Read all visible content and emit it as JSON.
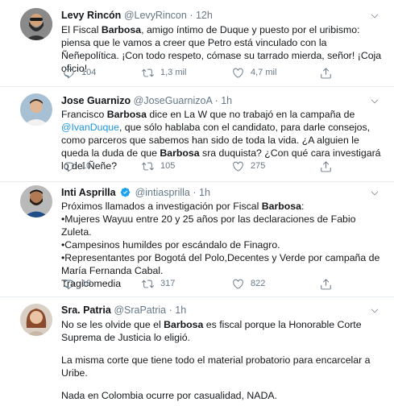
{
  "tweets": [
    {
      "name": "Levy Rincón",
      "handle": "@LevyRincon",
      "sep": "·",
      "time": "12h",
      "avatar_icon": "bearded-man-avatar",
      "text_parts": [
        "El Fiscal ",
        "Barbosa",
        ", amigo íntimo de Duque y puesto por el uribismo: piensa que le vamos a creer que Petro está vinculado con la Ñeñepolítica. ¡Con todo respeto, cómase su tarrado mierda, señor! ¡Coja oficio!"
      ],
      "reply": "104",
      "retweet": "1,3 mil",
      "like": "4,7 mil"
    },
    {
      "name": "Jose Guarnizo",
      "handle": "@JoseGuarnizoA",
      "sep": "·",
      "time": "1h",
      "avatar_icon": "man-avatar",
      "text_parts": [
        "Francisco ",
        "Barbosa",
        " dice en La W que no trabajó en la campaña de ",
        "@IvanDuque",
        ", que sólo hablaba con el candidato, para darle consejos, como parceros que sabemos han sido de toda la vida. ¿A alguien le queda la duda de que ",
        "Barbosa",
        " sra duquista? ¿Con qué cara investigará lo del Ñeñe?"
      ],
      "reply": "10",
      "retweet": "105",
      "like": "275"
    },
    {
      "name": "Inti Asprilla",
      "handle": "@intiasprilla",
      "sep": "·",
      "time": "1h",
      "avatar_icon": "man-with-beard-avatar",
      "lines": [
        [
          "Próximos llamados a investigación por Fiscal ",
          "Barbosa",
          ":"
        ],
        [
          "•Mujeres Wayuu entre 20 y 25 años por las declaraciones de Fabio Zuleta."
        ],
        [
          "•Campesinos humildes por escándalo de Finagro."
        ],
        [
          "•Representantes por Bogotá del Polo,Decentes y Verde por campaña de María Fernanda Cabal."
        ],
        [
          "Tragicomedia"
        ]
      ],
      "reply": "18",
      "retweet": "317",
      "like": "822"
    },
    {
      "name": "Sra. Patria",
      "handle": "@SraPatria",
      "sep": "·",
      "time": "1h",
      "avatar_icon": "woman-avatar",
      "paragraphs": [
        [
          "No se les olvide que el ",
          "Barbosa",
          " es fiscal porque la Honorable Corte Suprema de Justicia lo eligió."
        ],
        [
          "La misma corte que tiene todo el material probatorio para encarcelar a Uribe."
        ],
        [
          "Nada en Colombia ocurre por casualidad, NADA."
        ]
      ]
    }
  ],
  "colors": {
    "text": "#14171a",
    "secondary": "#657786",
    "link": "#1b95e0",
    "verified": "#1da1f2",
    "divider": "#e6ecf0"
  }
}
